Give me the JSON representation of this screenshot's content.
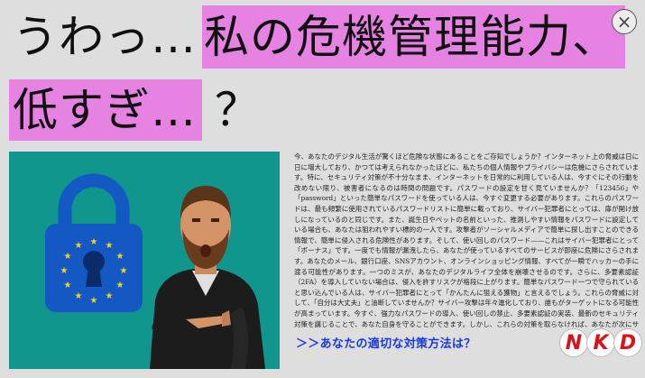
{
  "headline": {
    "line1_plain": "うわっ…",
    "line1_highlight": "私の危機管理能力、",
    "line2_highlight": "低すぎ…",
    "line2_plain": "？"
  },
  "close_button": {
    "glyph": "×"
  },
  "illustration": {
    "background_color": "#11968e",
    "icon": "padlock-with-eu-stars-icon",
    "figure": "bearded-man-pointing"
  },
  "article": {
    "text": "今、あなたのデジタル生活が驚くほど危険な状態にあることをご存知でしょうか？インターネット上の脅威は日に日に増大しており、かつては考えられなかったほどに、私たちの個人情報やプライバシーは危機にさらされています。特に、セキュリティ対策が不十分なまま、インターネットを日常的に利用している人は、今すぐにその行動を改めない限り、被害者になるのは時間の問題です。パスワードの設定を甘く見ていませんか？「123456」や「password」といった簡単なパスワードを使っている人は、今すぐ変更する必要があります。これらのパスワードは、最も頻繁に使用されているパスワードリストに簡単に載っており、サイバー犯罪者にとっては、扉が開け放しになっているのと同じです。また、誕生日やペットの名前といった、推測しやすい情報をパスワードに設定している場合も、あなたは狙われやすい標的の一人です。攻撃者がソーシャルメディアで簡単に探し出すことのできる情報で、簡単に侵入される危険性があります。そして、使い回しのパスワード——これはサイバー犯罪者にとって「ボーナス」です。一度でも情報が漏洩したら、あなたが使っているすべてのサービスが即座に危険にさらされます。あなたのメール、銀行口座、SNSアカウント、オンラインショッピング情報、すべてが一瞬でハッカーの手に渡る可能性があります。一つのミスが、あなたのデジタルライフ全体を崩壊させるのです。さらに、多要素認証（2FA）を導入していない場合は、侵入を許すリスクが格段に上がります。簡単なパスワード一つで守られていると思い込んでいる人は、サイバー犯罪者にとって「かんたんに狙える獲物」と言えるでしょう。これらの脅威に対して、「自分は大丈夫」と油断していませんか？サイバー攻撃は年々進化しており、誰もがターゲットになる可能性が高まっています。今すぐ、強力なパスワードの導入、使い回しの禁止、多要素認証の実装、最新のセキュリティ対策を講じることで、あなた自身を守ることができます。しかし、これらの対策を取らなければ、あなたが次にサイバー攻撃の被害者となる日はそう遠くないかもしれません。"
  },
  "cta": {
    "label": "＞＞あなたの適切な対策方法は？"
  },
  "logo": {
    "letters": [
      "N",
      "K",
      "D"
    ],
    "color": "#d8141a"
  }
}
